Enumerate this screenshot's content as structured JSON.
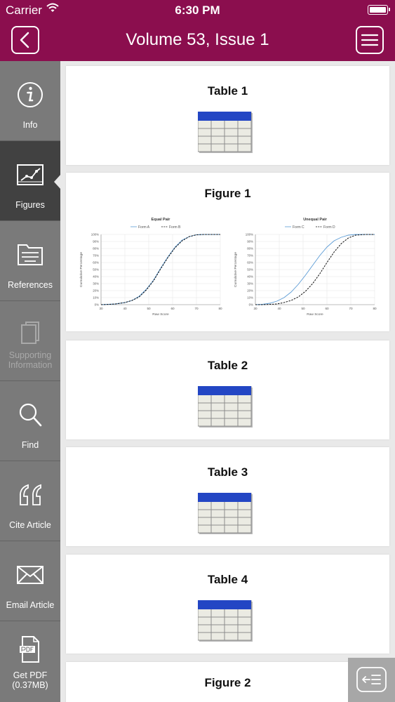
{
  "status_bar": {
    "carrier": "Carrier",
    "time": "6:30 PM"
  },
  "nav": {
    "title": "Volume 53, Issue 1",
    "back_icon": "chevron-left-icon",
    "menu_icon": "hamburger-menu-icon"
  },
  "colors": {
    "brand": "#8b0e4e",
    "sidebar": "#7a7a7a",
    "sidebar_active": "#414141",
    "table_header": "#2346c4",
    "series_blue": "#5b9bd5"
  },
  "sidebar": {
    "selected": "Figures",
    "items": [
      {
        "label": "Info",
        "icon": "info-icon"
      },
      {
        "label": "Figures",
        "icon": "figures-chart-icon"
      },
      {
        "label": "References",
        "icon": "references-folder-icon"
      },
      {
        "label": "Supporting Information",
        "icon": "supporting-info-icon",
        "disabled": true
      },
      {
        "label": "Find",
        "icon": "search-icon"
      },
      {
        "label": "Cite Article",
        "icon": "quote-icon"
      },
      {
        "label": "Email Article",
        "icon": "email-icon"
      },
      {
        "label": "Get PDF (0.37MB)",
        "icon": "pdf-icon"
      }
    ]
  },
  "cards": [
    {
      "title": "Table 1",
      "kind": "table"
    },
    {
      "title": "Figure 1",
      "kind": "figure"
    },
    {
      "title": "Table 2",
      "kind": "table"
    },
    {
      "title": "Table 3",
      "kind": "table"
    },
    {
      "title": "Table 4",
      "kind": "table"
    },
    {
      "title": "Figure 2",
      "kind": "figure"
    }
  ],
  "toggle_icon": "collapse-sidebar-icon",
  "chart_data": [
    {
      "type": "line",
      "title": "Equal Pair",
      "xlabel": "Raw Score",
      "ylabel": "Cumulative Percentage",
      "xlim": [
        30,
        80
      ],
      "ylim": [
        0,
        100
      ],
      "x_ticks": [
        "30",
        "40",
        "50",
        "60",
        "70",
        "80"
      ],
      "y_ticks": [
        "0%",
        "10%",
        "20%",
        "30%",
        "40%",
        "50%",
        "60%",
        "70%",
        "80%",
        "90%",
        "100%"
      ],
      "legend": "top",
      "series": [
        {
          "name": "Form A",
          "style": "solid",
          "x": [
            30,
            33,
            36,
            40,
            43,
            46,
            49,
            52,
            55,
            58,
            61,
            64,
            67,
            70,
            73,
            76,
            80
          ],
          "y": [
            0,
            0.5,
            1,
            3,
            6,
            12,
            22,
            35,
            52,
            68,
            82,
            92,
            97,
            99.5,
            100,
            100,
            100
          ]
        },
        {
          "name": "Form B",
          "style": "dashed",
          "x": [
            30,
            33,
            36,
            40,
            43,
            46,
            49,
            52,
            55,
            58,
            61,
            64,
            67,
            70,
            73,
            76,
            80
          ],
          "y": [
            0,
            0.4,
            1,
            3,
            6,
            11,
            21,
            34,
            51,
            67,
            81,
            91,
            97,
            99.5,
            100,
            100,
            100
          ]
        }
      ]
    },
    {
      "type": "line",
      "title": "Unequal Pair",
      "xlabel": "Raw Score",
      "ylabel": "Cumulative Percentage",
      "xlim": [
        30,
        80
      ],
      "ylim": [
        0,
        100
      ],
      "x_ticks": [
        "30",
        "40",
        "50",
        "60",
        "70",
        "80"
      ],
      "y_ticks": [
        "0%",
        "10%",
        "20%",
        "30%",
        "40%",
        "50%",
        "60%",
        "70%",
        "80%",
        "90%",
        "100%"
      ],
      "legend": "top",
      "series": [
        {
          "name": "Form C",
          "style": "solid",
          "x": [
            30,
            33,
            36,
            39,
            42,
            45,
            48,
            51,
            54,
            57,
            60,
            63,
            66,
            69,
            72,
            76,
            80
          ],
          "y": [
            0,
            0.5,
            2,
            5,
            10,
            18,
            29,
            42,
            56,
            70,
            82,
            91,
            96,
            99,
            100,
            100,
            100
          ]
        },
        {
          "name": "Form D",
          "style": "dashed",
          "x": [
            30,
            33,
            36,
            39,
            42,
            45,
            48,
            51,
            54,
            57,
            60,
            63,
            66,
            69,
            72,
            76,
            80
          ],
          "y": [
            0,
            0,
            0.5,
            1,
            3,
            6,
            11,
            19,
            30,
            44,
            60,
            75,
            87,
            95,
            99,
            100,
            100
          ]
        }
      ]
    }
  ]
}
